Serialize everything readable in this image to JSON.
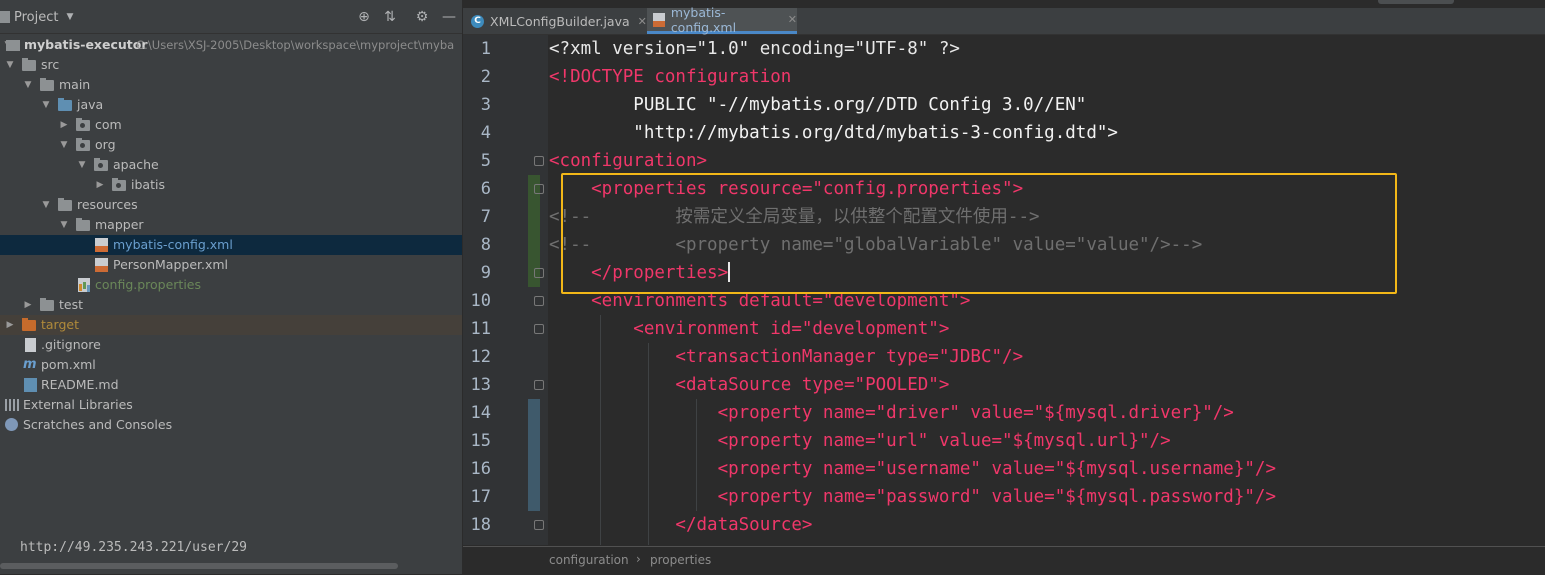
{
  "project_panel": {
    "title": "Project",
    "tree": [
      {
        "label": "mybatis-executor",
        "path": "C:\\Users\\XSJ-2005\\Desktop\\workspace\\myproject\\myba"
      },
      {
        "label": "src"
      },
      {
        "label": "main"
      },
      {
        "label": "java"
      },
      {
        "label": "com"
      },
      {
        "label": "org"
      },
      {
        "label": "apache"
      },
      {
        "label": "ibatis"
      },
      {
        "label": "resources"
      },
      {
        "label": "mapper"
      },
      {
        "label": "mybatis-config.xml"
      },
      {
        "label": "PersonMapper.xml"
      },
      {
        "label": "config.properties"
      },
      {
        "label": "test"
      },
      {
        "label": "target"
      },
      {
        "label": ".gitignore"
      },
      {
        "label": "pom.xml"
      },
      {
        "label": "README.md"
      },
      {
        "label": "External Libraries"
      },
      {
        "label": "Scratches and Consoles"
      }
    ],
    "status_url": "http://49.235.243.221/user/29"
  },
  "tabs": [
    {
      "label": "XMLConfigBuilder.java",
      "icon": "java-class-icon"
    },
    {
      "label": "mybatis-config.xml",
      "icon": "xml-file-icon",
      "active": true
    }
  ],
  "editor": {
    "line_numbers": [
      "1",
      "2",
      "3",
      "4",
      "5",
      "6",
      "7",
      "8",
      "9",
      "10",
      "11",
      "12",
      "13",
      "14",
      "15",
      "16",
      "17",
      "18"
    ],
    "lines": [
      {
        "text": "<?xml version=\"1.0\" encoding=\"UTF-8\" ?>"
      },
      {
        "text": "<!DOCTYPE configuration"
      },
      {
        "text": "        PUBLIC \"-//mybatis.org//DTD Config 3.0//EN\""
      },
      {
        "text": "        \"http://mybatis.org/dtd/mybatis-3-config.dtd\">"
      },
      {
        "text": "<configuration>"
      },
      {
        "text": "    <properties resource=\"config.properties\">"
      },
      {
        "text": "<!--        按需定义全局变量，以供整个配置文件使用-->"
      },
      {
        "text": "<!--        <property name=\"globalVariable\" value=\"value\"/>-->"
      },
      {
        "text": "    </properties>"
      },
      {
        "text": "    <environments default=\"development\">"
      },
      {
        "text": "        <environment id=\"development\">"
      },
      {
        "text": "            <transactionManager type=\"JDBC\"/>"
      },
      {
        "text": "            <dataSource type=\"POOLED\">"
      },
      {
        "text": "                <property name=\"driver\" value=\"${mysql.driver}\"/>"
      },
      {
        "text": "                <property name=\"url\" value=\"${mysql.url}\"/>"
      },
      {
        "text": "                <property name=\"username\" value=\"${mysql.username}\"/>"
      },
      {
        "text": "                <property name=\"password\" value=\"${mysql.password}\"/>"
      },
      {
        "text": "            </dataSource>"
      }
    ],
    "breadcrumbs": [
      "configuration",
      "properties"
    ]
  }
}
